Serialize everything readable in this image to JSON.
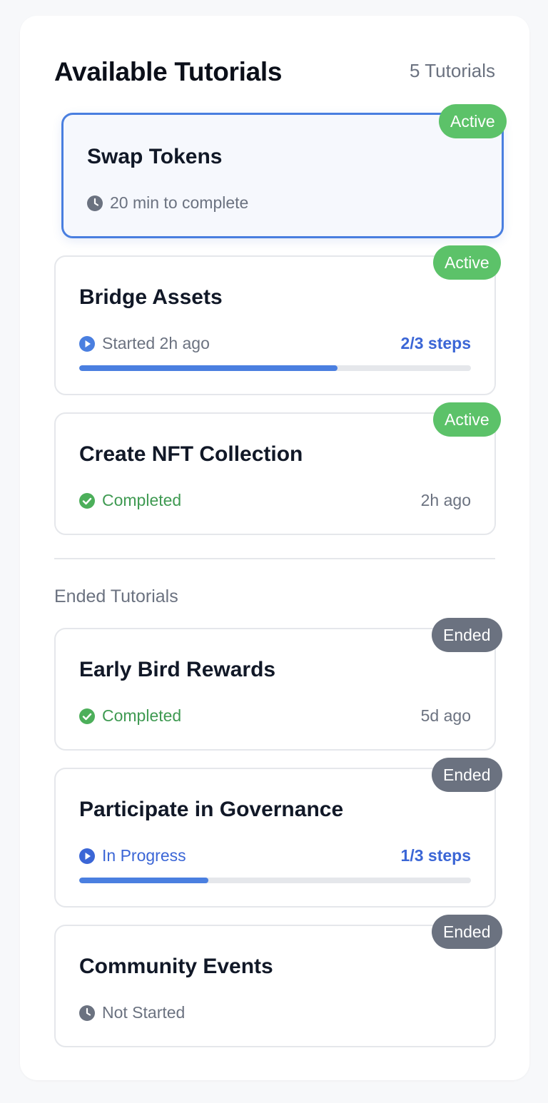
{
  "header": {
    "title": "Available Tutorials",
    "count": "5 Tutorials"
  },
  "active_tutorials": [
    {
      "title": "Swap Tokens",
      "status": "20 min to complete",
      "status_icon": "clock-icon",
      "badge": "Active",
      "selected": true
    },
    {
      "title": "Bridge Assets",
      "status": "Started 2h ago",
      "status_icon": "play-icon",
      "steps": "2/3 steps",
      "progress": 0.66,
      "badge": "Active"
    },
    {
      "title": "Create NFT Collection",
      "status": "Completed",
      "status_icon": "check-circle-icon",
      "time": "2h ago",
      "badge": "Active"
    }
  ],
  "ended_section": {
    "label": "Ended Tutorials"
  },
  "ended_tutorials": [
    {
      "title": "Early Bird Rewards",
      "status": "Completed",
      "status_icon": "check-circle-icon",
      "time": "5d ago",
      "badge": "Ended"
    },
    {
      "title": "Participate in Governance",
      "status": "In Progress",
      "status_icon": "play-icon",
      "steps": "1/3 steps",
      "progress": 0.33,
      "badge": "Ended"
    },
    {
      "title": "Community Events",
      "status": "Not Started",
      "status_icon": "clock-icon",
      "badge": "Ended"
    }
  ],
  "colors": {
    "accent_blue": "#4a7fe0",
    "active_badge": "#5cc269",
    "ended_badge": "#6b7280",
    "completed_green": "#3f9a52"
  }
}
